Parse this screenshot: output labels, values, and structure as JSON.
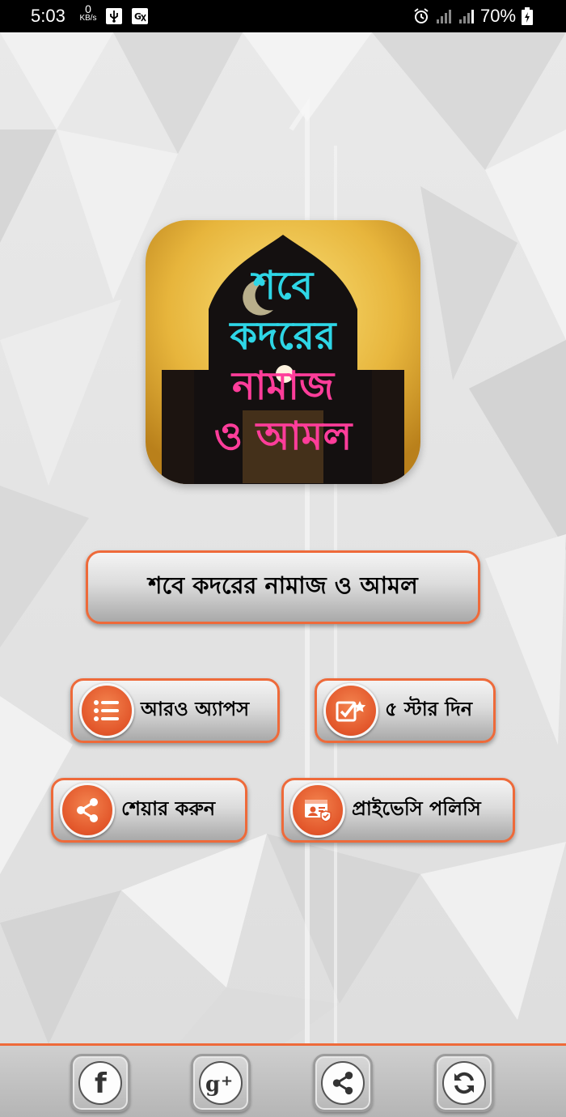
{
  "status_bar": {
    "time": "5:03",
    "net_speed_value": "0",
    "net_speed_unit": "KB/s",
    "battery": "70%",
    "icons": [
      "usb-icon",
      "translate-icon",
      "alarm-icon",
      "signal-icon",
      "signal-icon",
      "battery-charging-icon"
    ]
  },
  "app_icon": {
    "lines": [
      "শবে",
      "কদরের",
      "নামাজ",
      "ও আমল"
    ],
    "colors": {
      "line1": "#2ed6e6",
      "line2": "#2ed6e6",
      "line3": "#ff3d9a",
      "line4": "#ff3d9a"
    }
  },
  "main_button": {
    "label": "শবে কদরের নামাজ ও আমল"
  },
  "menu": {
    "more_apps": {
      "label": "আরও অ্যাপস",
      "icon": "list-icon"
    },
    "rate": {
      "label": "৫ স্টার দিন",
      "icon": "rate-star-icon"
    },
    "share": {
      "label": "শেয়ার করুন",
      "icon": "share-icon"
    },
    "privacy": {
      "label": "প্রাইভেসি পলিসি",
      "icon": "privacy-policy-icon"
    }
  },
  "bottom_bar": {
    "items": [
      "facebook-icon",
      "google-plus-icon",
      "share-icon",
      "refresh-icon"
    ]
  },
  "colors": {
    "accent": "#ee6a3a",
    "icon_bg": "#e2562a",
    "statusbar": "#000000"
  }
}
